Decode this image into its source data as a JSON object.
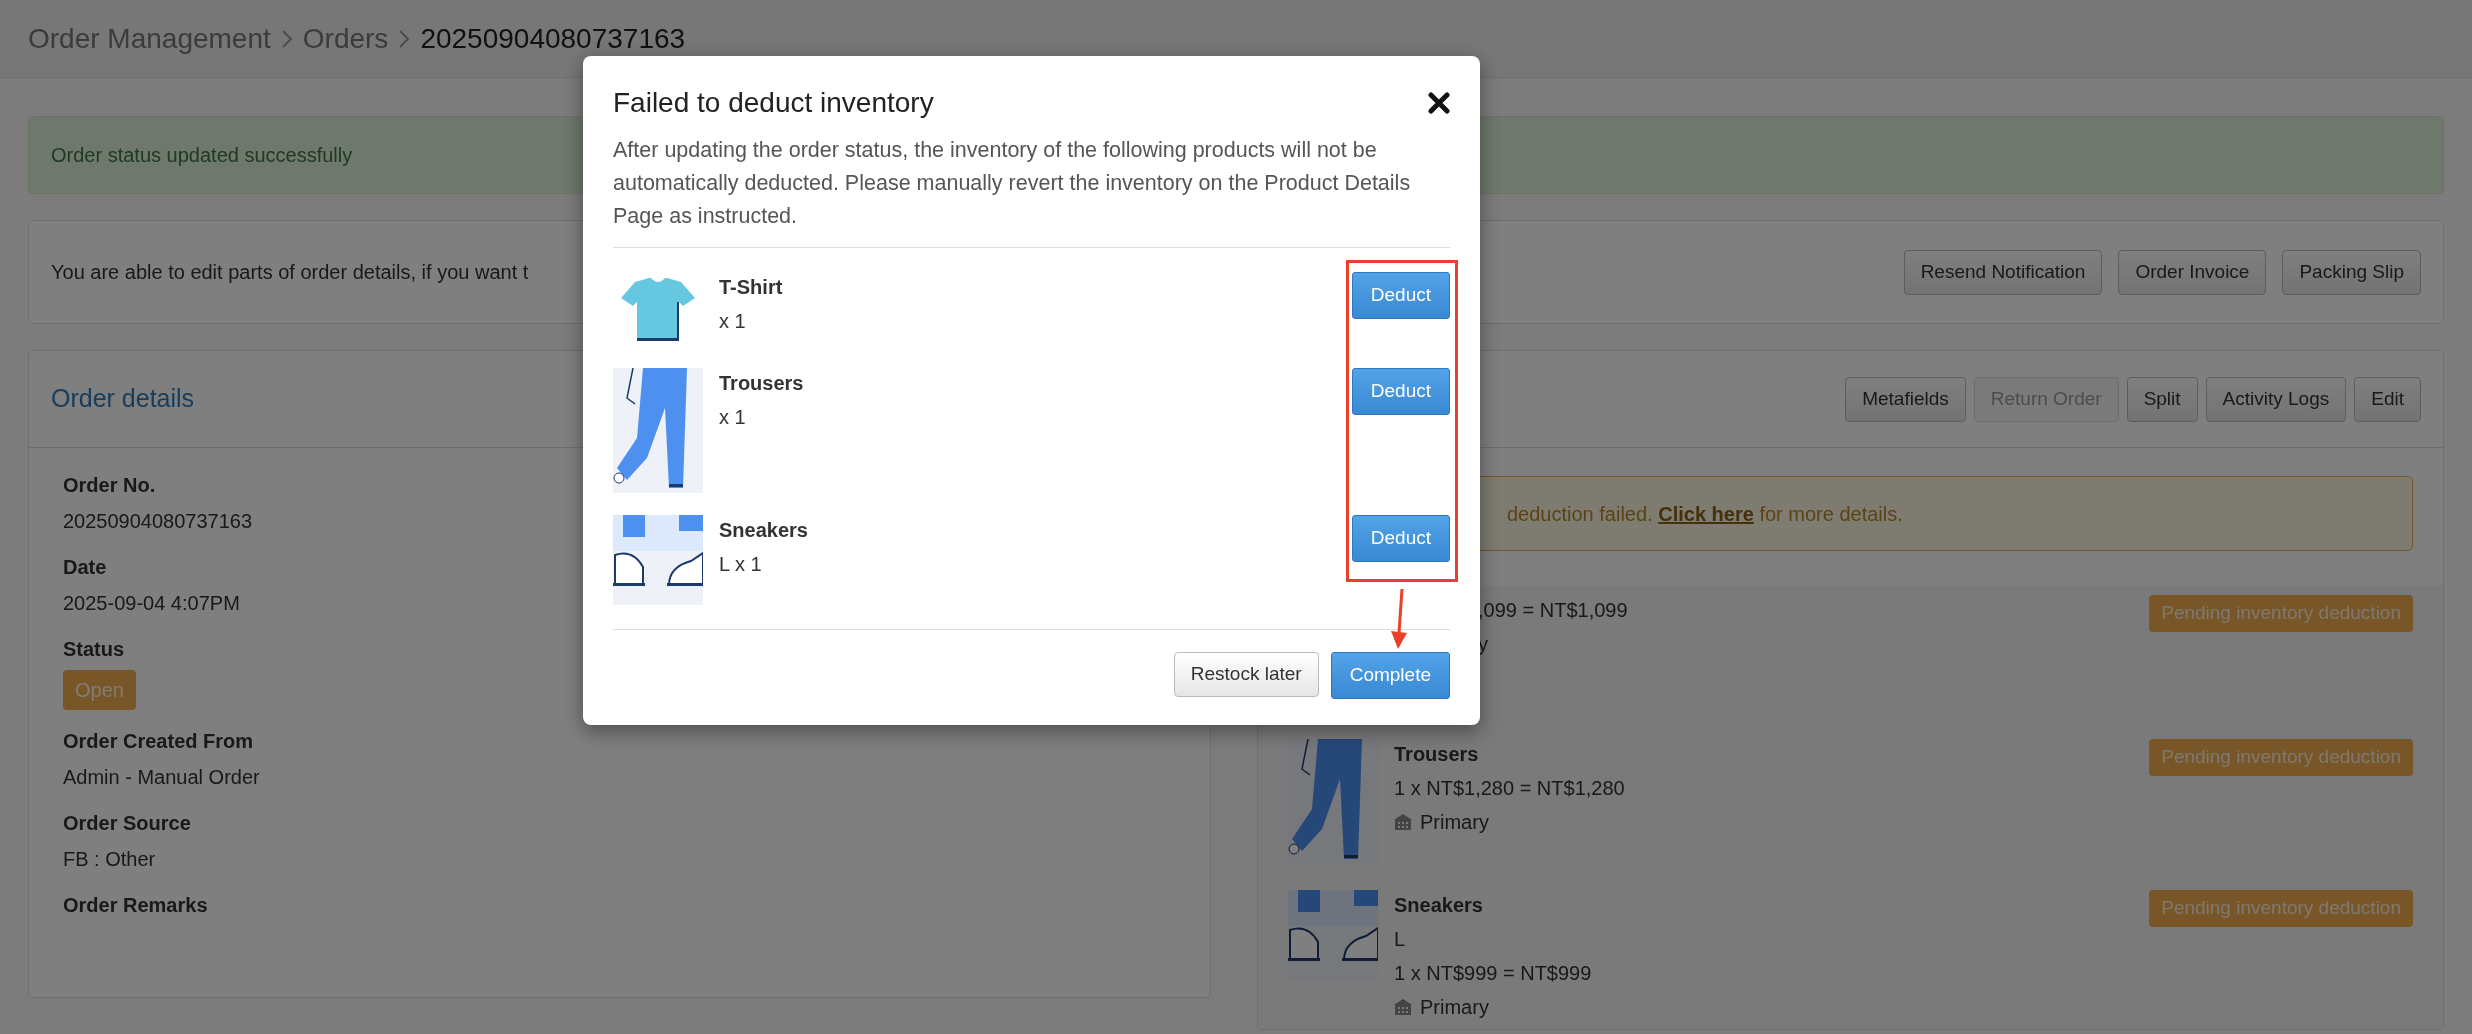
{
  "breadcrumb": [
    {
      "label": "Order Management",
      "current": false
    },
    {
      "label": "Orders",
      "current": false
    },
    {
      "label": "20250904080737163",
      "current": true
    }
  ],
  "alert": {
    "text": "Order status updated successfully"
  },
  "notice": {
    "text": "You are able to edit parts of order details, if you want t",
    "buttons": [
      "Resend Notification",
      "Order Invoice",
      "Packing Slip"
    ]
  },
  "order_details": {
    "title": "Order details",
    "fields": [
      {
        "label": "Order No.",
        "value": "20250904080737163",
        "kind": "text"
      },
      {
        "label": "Date",
        "value": "2025-09-04 4:07PM",
        "kind": "text"
      },
      {
        "label": "Status",
        "value": "Open",
        "kind": "badge"
      },
      {
        "label": "Order Created From",
        "value": "Admin - Manual Order",
        "kind": "text"
      },
      {
        "label": "Order Source",
        "value": "FB : Other",
        "kind": "text"
      },
      {
        "label": "Order Remarks"
      }
    ]
  },
  "items_panel": {
    "buttons": [
      {
        "label": "Metafields",
        "disabled": false
      },
      {
        "label": "Return Order",
        "disabled": true
      },
      {
        "label": "Split",
        "disabled": false
      },
      {
        "label": "Activity Logs",
        "disabled": false
      },
      {
        "label": "Edit",
        "disabled": false
      }
    ],
    "warning": {
      "before": "deduction failed.",
      "link": "Click here",
      "after": "for more details."
    },
    "items": [
      {
        "kind": "covered",
        "price": ",099 = NT$1,099",
        "warehouse": "y",
        "badge": "Pending inventory deduction"
      },
      {
        "kind": "full",
        "name": "Trousers",
        "price": "1 x NT$1,280 = NT$1,280",
        "warehouse": "Primary",
        "badge": "Pending inventory deduction"
      },
      {
        "kind": "full",
        "name": "Sneakers",
        "variant": "L",
        "price": "1 x NT$999 = NT$999",
        "warehouse": "Primary",
        "badge": "Pending inventory deduction"
      }
    ]
  },
  "modal": {
    "title": "Failed to deduct inventory",
    "description": "After updating the order status, the inventory of the following products will not be automatically deducted. Please manually revert the inventory on the Product Details Page as instructed.",
    "items": [
      {
        "name": "T-Shirt",
        "quantity": "x 1",
        "action": "Deduct"
      },
      {
        "name": "Trousers",
        "quantity": "x 1",
        "action": "Deduct"
      },
      {
        "name": "Sneakers",
        "quantity": "L x 1",
        "action": "Deduct"
      }
    ],
    "buttons": [
      {
        "label": "Restock later",
        "kind": "secondary"
      },
      {
        "label": "Complete",
        "kind": "primary"
      }
    ]
  }
}
